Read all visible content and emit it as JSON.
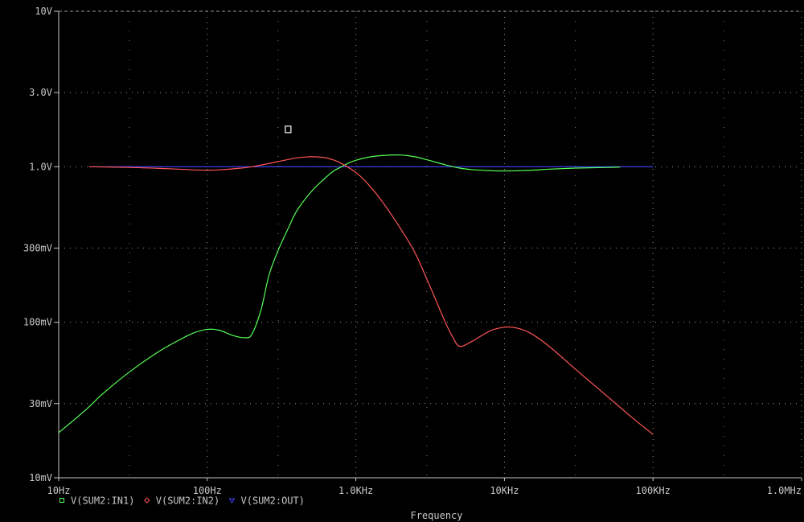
{
  "chart_data": {
    "type": "line",
    "x_scale": "log",
    "y_scale": "log",
    "xlim": [
      10,
      1000000
    ],
    "ylim": [
      0.01,
      10
    ],
    "grid": true,
    "xlabel": "Frequency",
    "x_tick_values": [
      10,
      100,
      1000,
      10000,
      100000,
      1000000
    ],
    "x_tick_labels": [
      "10Hz",
      "100Hz",
      "1.0KHz",
      "10KHz",
      "100KHz",
      "1.0MHz"
    ],
    "y_tick_values": [
      0.01,
      0.03,
      0.1,
      0.3,
      1,
      3,
      10
    ],
    "y_tick_labels": [
      "10mV",
      "30mV",
      "100mV",
      "300mV",
      "1.0V",
      "3.0V",
      "10V"
    ],
    "legend_position": "bottom-left",
    "series": [
      {
        "name": "V(SUM2:IN1)",
        "color": "#55ff55",
        "marker": "square",
        "x": [
          10,
          15,
          20,
          30,
          45,
          60,
          80,
          100,
          120,
          150,
          180,
          200,
          230,
          260,
          300,
          350,
          400,
          500,
          600,
          700,
          800,
          900,
          1000,
          1200,
          1500,
          2000,
          2500,
          3000,
          4000,
          5000,
          6000,
          8000,
          10000,
          15000,
          20000,
          30000,
          50000,
          60000
        ],
        "y": [
          0.0195,
          0.027,
          0.035,
          0.048,
          0.063,
          0.074,
          0.085,
          0.09,
          0.089,
          0.082,
          0.0795,
          0.084,
          0.12,
          0.2,
          0.29,
          0.4,
          0.52,
          0.69,
          0.82,
          0.93,
          1.0,
          1.06,
          1.1,
          1.15,
          1.18,
          1.19,
          1.16,
          1.11,
          1.03,
          0.98,
          0.96,
          0.945,
          0.94,
          0.95,
          0.965,
          0.98,
          0.99,
          0.995
        ]
      },
      {
        "name": "V(SUM2:IN2)",
        "color": "#ff5555",
        "marker": "diamond",
        "x": [
          16,
          30,
          50,
          80,
          100,
          120,
          150,
          200,
          300,
          400,
          500,
          600,
          700,
          800,
          1000,
          1200,
          1500,
          2000,
          2500,
          3000,
          3500,
          4000,
          4500,
          5000,
          6000,
          8000,
          10000,
          12000,
          15000,
          20000,
          30000,
          50000,
          70000,
          100000
        ],
        "y": [
          1.0,
          0.99,
          0.975,
          0.955,
          0.95,
          0.955,
          0.97,
          1.0,
          1.08,
          1.14,
          1.16,
          1.15,
          1.11,
          1.05,
          0.92,
          0.78,
          0.6,
          0.4,
          0.28,
          0.19,
          0.135,
          0.1,
          0.08,
          0.07,
          0.075,
          0.088,
          0.093,
          0.092,
          0.085,
          0.07,
          0.05,
          0.033,
          0.025,
          0.019
        ]
      },
      {
        "name": "V(SUM2:OUT)",
        "color": "#4444ff",
        "marker": "triangle",
        "x": [
          16,
          100000
        ],
        "y": [
          1.0,
          1.0
        ]
      }
    ],
    "annotation_marker": {
      "x": 350,
      "y": 1.75
    }
  }
}
